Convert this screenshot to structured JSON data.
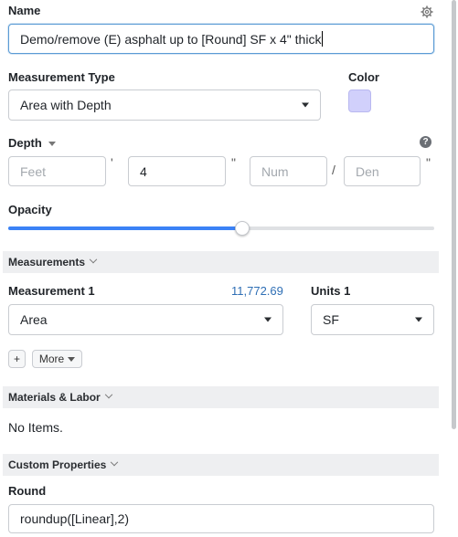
{
  "name": {
    "label": "Name",
    "value": "Demo/remove (E) asphalt up to [Round] SF x 4\" thick"
  },
  "measurement_type": {
    "label": "Measurement Type",
    "selected": "Area with Depth"
  },
  "color": {
    "label": "Color",
    "swatch": "#d1d0fb"
  },
  "depth": {
    "label": "Depth",
    "feet_placeholder": "Feet",
    "feet_unit": "'",
    "inches_value": "4",
    "inches_unit": "\"",
    "num_placeholder": "Num",
    "slash": "/",
    "den_placeholder": "Den",
    "fraction_unit": "\""
  },
  "opacity": {
    "label": "Opacity",
    "level": 0.55,
    "accent": "#3b82f6"
  },
  "measurements": {
    "header": "Measurements",
    "item_label": "Measurement 1",
    "item_value": "11,772.69",
    "item_type": "Area",
    "units_label": "Units 1",
    "units_value": "SF",
    "add_label": "+",
    "more_label": "More"
  },
  "materials": {
    "header": "Materials & Labor",
    "empty_text": "No Items."
  },
  "custom_properties": {
    "header": "Custom Properties",
    "round_label": "Round",
    "round_value": "roundup([Linear],2)"
  }
}
